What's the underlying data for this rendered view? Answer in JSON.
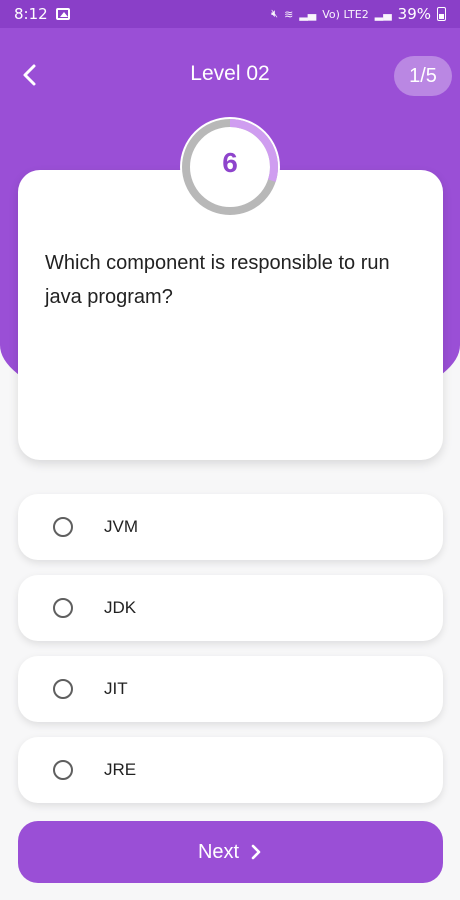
{
  "status_bar": {
    "time": "8:12",
    "battery": "39%",
    "network_label": "Vo) LTE2"
  },
  "header": {
    "title": "Level 02",
    "progress": "1/5"
  },
  "timer": {
    "value": "6",
    "remaining_fraction": 0.3
  },
  "question": {
    "text": "Which component is responsible to run java program?"
  },
  "options": [
    {
      "label": "JVM"
    },
    {
      "label": "JDK"
    },
    {
      "label": "JIT"
    },
    {
      "label": "JRE"
    }
  ],
  "next_button": {
    "label": "Next"
  },
  "colors": {
    "primary": "#9a4fd6",
    "status_bar": "#8a3fc8",
    "timer_track": "#b8b8b8",
    "timer_fill": "#cf9df0",
    "timer_text": "#8e44cc"
  },
  "icons": {
    "back": "chevron-left-icon",
    "next": "chevron-right-icon",
    "image": "image-icon",
    "mute": "mute-icon",
    "wifi": "wifi-icon",
    "signal": "signal-icon",
    "battery": "battery-icon"
  }
}
